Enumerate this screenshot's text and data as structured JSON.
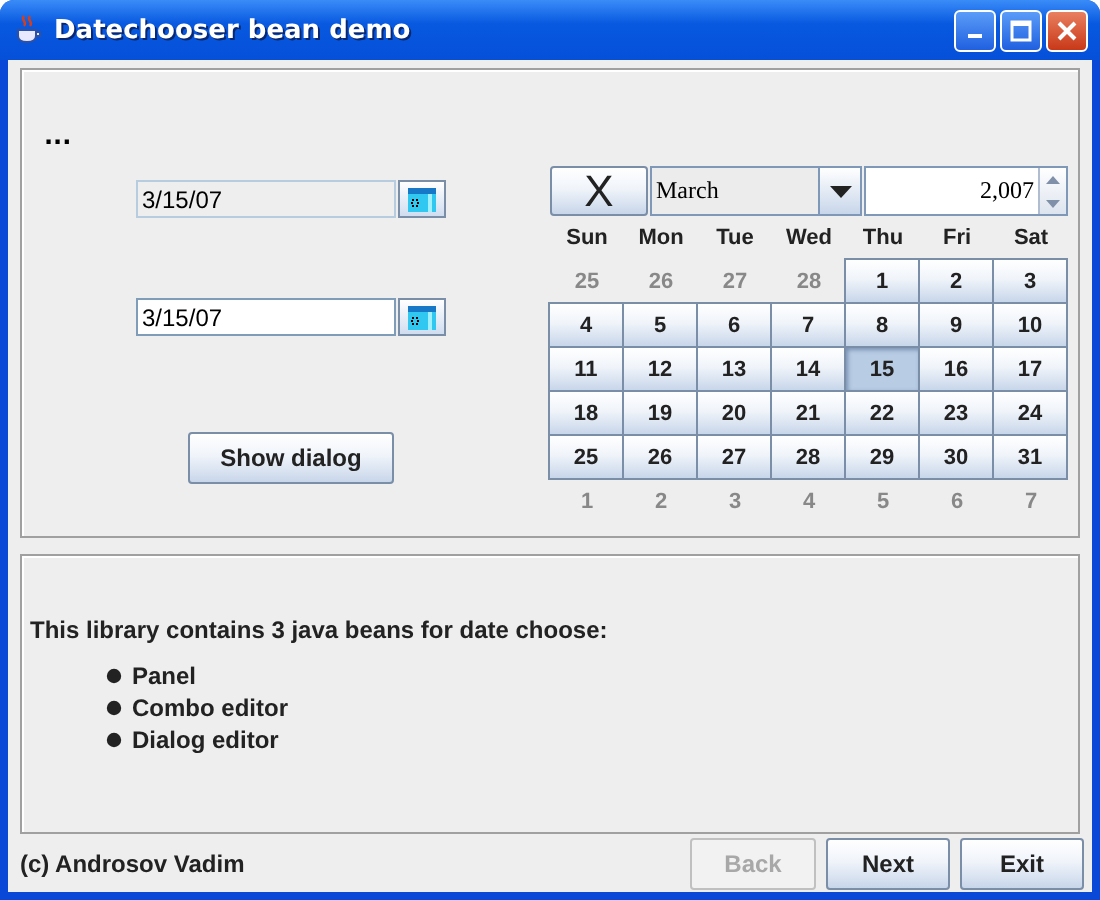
{
  "window": {
    "title": "Datechooser bean demo"
  },
  "ellipsis": "...",
  "date_fields": [
    {
      "value": "3/15/07",
      "disabled": true
    },
    {
      "value": "3/15/07",
      "disabled": false
    }
  ],
  "show_dialog_button": "Show dialog",
  "calendar": {
    "clear_button": "X",
    "month": "March",
    "year": "2,007",
    "weekdays": [
      "Sun",
      "Mon",
      "Tue",
      "Wed",
      "Thu",
      "Fri",
      "Sat"
    ],
    "days": [
      {
        "label": "25",
        "kind": "other"
      },
      {
        "label": "26",
        "kind": "other"
      },
      {
        "label": "27",
        "kind": "other"
      },
      {
        "label": "28",
        "kind": "other"
      },
      {
        "label": "1",
        "kind": "day",
        "selected": false
      },
      {
        "label": "2",
        "kind": "day",
        "selected": false
      },
      {
        "label": "3",
        "kind": "day",
        "selected": false
      },
      {
        "label": "4",
        "kind": "day",
        "selected": false
      },
      {
        "label": "5",
        "kind": "day",
        "selected": false
      },
      {
        "label": "6",
        "kind": "day",
        "selected": false
      },
      {
        "label": "7",
        "kind": "day",
        "selected": false
      },
      {
        "label": "8",
        "kind": "day",
        "selected": false
      },
      {
        "label": "9",
        "kind": "day",
        "selected": false
      },
      {
        "label": "10",
        "kind": "day",
        "selected": false
      },
      {
        "label": "11",
        "kind": "day",
        "selected": false
      },
      {
        "label": "12",
        "kind": "day",
        "selected": false
      },
      {
        "label": "13",
        "kind": "day",
        "selected": false
      },
      {
        "label": "14",
        "kind": "day",
        "selected": false
      },
      {
        "label": "15",
        "kind": "day",
        "selected": true
      },
      {
        "label": "16",
        "kind": "day",
        "selected": false
      },
      {
        "label": "17",
        "kind": "day",
        "selected": false
      },
      {
        "label": "18",
        "kind": "day",
        "selected": false
      },
      {
        "label": "19",
        "kind": "day",
        "selected": false
      },
      {
        "label": "20",
        "kind": "day",
        "selected": false
      },
      {
        "label": "21",
        "kind": "day",
        "selected": false
      },
      {
        "label": "22",
        "kind": "day",
        "selected": false
      },
      {
        "label": "23",
        "kind": "day",
        "selected": false
      },
      {
        "label": "24",
        "kind": "day",
        "selected": false
      },
      {
        "label": "25",
        "kind": "day",
        "selected": false
      },
      {
        "label": "26",
        "kind": "day",
        "selected": false
      },
      {
        "label": "27",
        "kind": "day",
        "selected": false
      },
      {
        "label": "28",
        "kind": "day",
        "selected": false
      },
      {
        "label": "29",
        "kind": "day",
        "selected": false
      },
      {
        "label": "30",
        "kind": "day",
        "selected": false
      },
      {
        "label": "31",
        "kind": "day",
        "selected": false
      },
      {
        "label": "1",
        "kind": "other"
      },
      {
        "label": "2",
        "kind": "other"
      },
      {
        "label": "3",
        "kind": "other"
      },
      {
        "label": "4",
        "kind": "other"
      },
      {
        "label": "5",
        "kind": "other"
      },
      {
        "label": "6",
        "kind": "other"
      },
      {
        "label": "7",
        "kind": "other"
      }
    ]
  },
  "description": {
    "intro": "This library contains 3 java beans for date choose:",
    "items": [
      "Panel",
      "Combo editor",
      "Dialog editor"
    ]
  },
  "footer": {
    "copyright": "(c) Androsov Vadim",
    "buttons": [
      {
        "label": "Back",
        "disabled": true
      },
      {
        "label": "Next",
        "disabled": false
      },
      {
        "label": "Exit",
        "disabled": false
      }
    ]
  }
}
